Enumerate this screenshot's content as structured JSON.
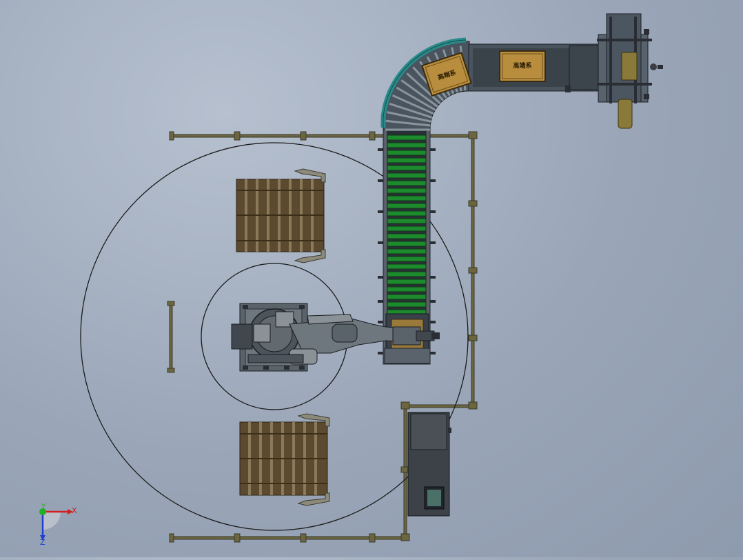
{
  "scene": {
    "background_top": "#b6c0cf",
    "background_bottom": "#8e9aad",
    "conveyor_roller_color": "#1e8a2e",
    "pallet_color": "#5b4a2f",
    "carton_color": "#b88d3e",
    "conveyor_guard_color": "#2a8a8a",
    "carton_label_1": "高端系",
    "carton_label_2": "高端系"
  },
  "triad": {
    "x_label": "X",
    "y_label": "Y",
    "z_label": "Z",
    "x_color": "#d02020",
    "y_color": "#20b020",
    "z_color": "#2040d0"
  }
}
